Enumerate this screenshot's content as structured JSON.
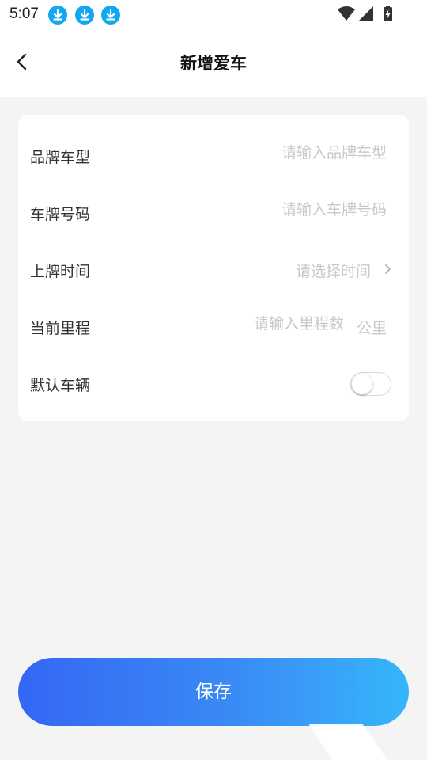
{
  "status_bar": {
    "time": "5:07",
    "notification_icons": [
      "download-icon",
      "download-icon",
      "download-icon"
    ],
    "system_icons": [
      "wifi-icon",
      "signal-icon",
      "battery-charging-icon"
    ]
  },
  "header": {
    "title": "新增爱车",
    "back_icon": "chevron-left-icon"
  },
  "form": {
    "brand_model": {
      "label": "品牌车型",
      "placeholder": "请输入品牌车型"
    },
    "plate_number": {
      "label": "车牌号码",
      "placeholder": "请输入车牌号码"
    },
    "register_time": {
      "label": "上牌时间",
      "placeholder": "请选择时间",
      "icon": "chevron-right-icon"
    },
    "mileage": {
      "label": "当前里程",
      "placeholder": "请输入里程数",
      "unit": "公里"
    },
    "default_vehicle": {
      "label": "默认车辆",
      "enabled": false
    }
  },
  "save_button": {
    "label": "保存"
  },
  "colors": {
    "accent_start": "#3467f4",
    "accent_end": "#36b6fb",
    "notification_icon": "#12a8ef",
    "background": "#f4f4f5",
    "placeholder": "#c8c8cc"
  }
}
